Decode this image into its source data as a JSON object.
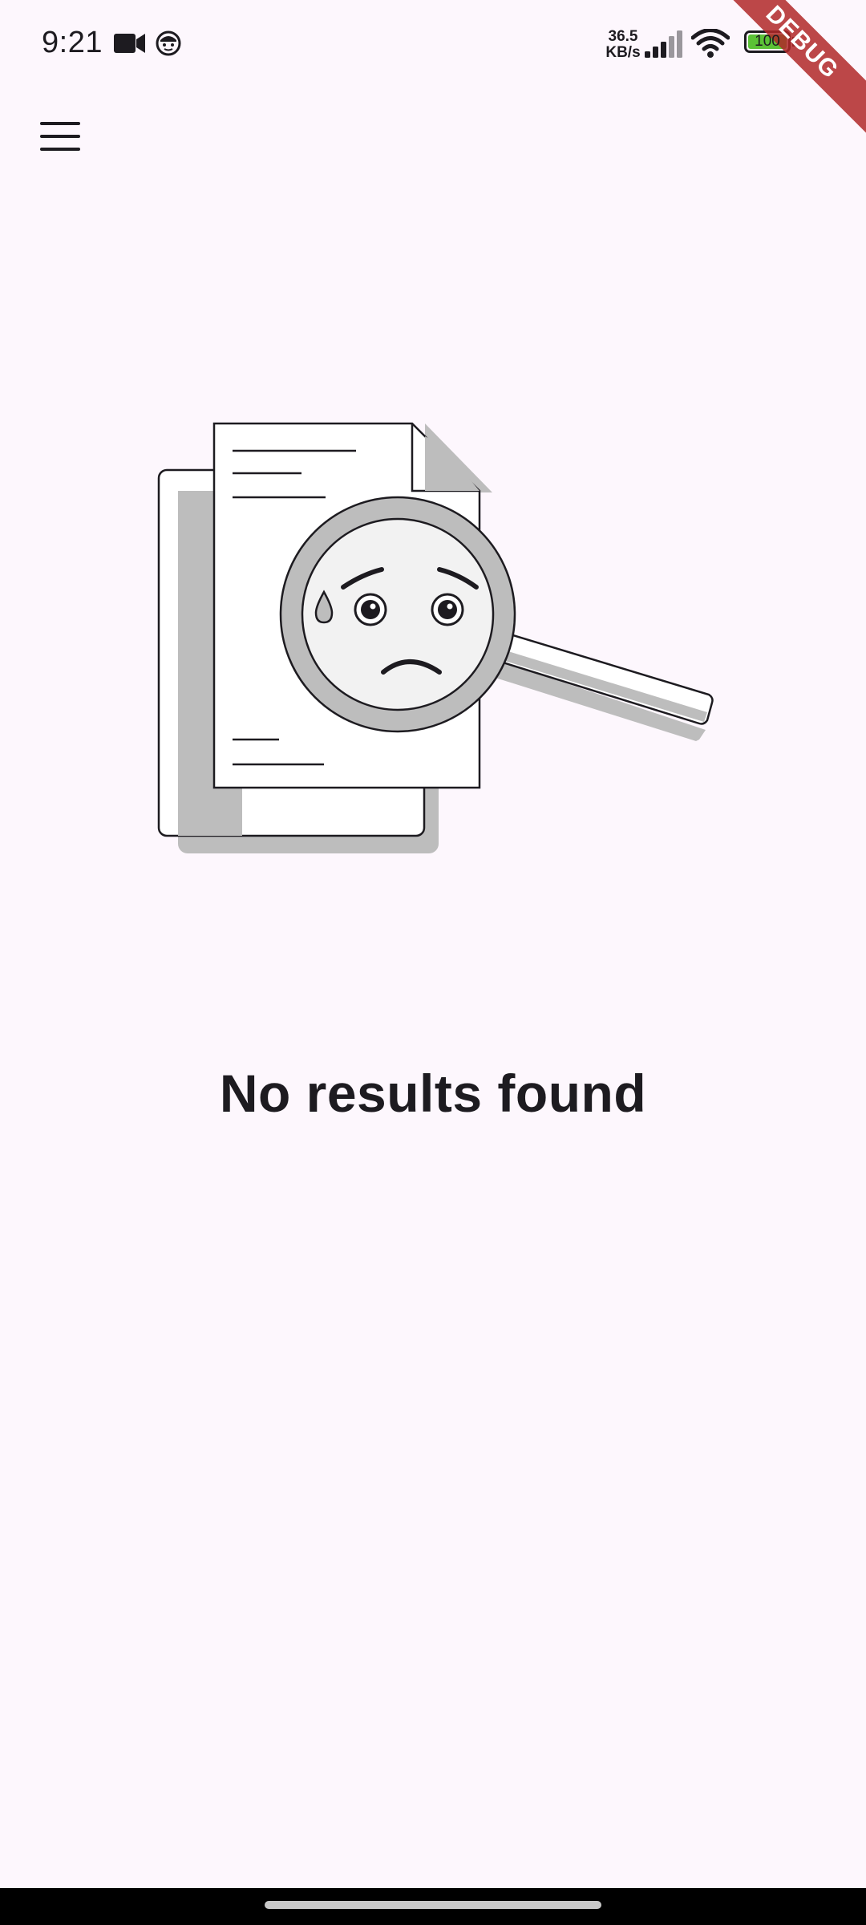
{
  "status_bar": {
    "time": "9:21",
    "net_speed_value": "36.5",
    "net_speed_unit": "KB/s",
    "battery_level": "100",
    "battery_fraction": 1.0,
    "icons": [
      "video-camera-icon",
      "face-icon",
      "signal-icon",
      "wifi-icon",
      "battery-icon"
    ]
  },
  "debug_banner": {
    "label": "DEBUG",
    "color": "#b02828"
  },
  "app_bar": {
    "menu_icon": "hamburger-menu-icon"
  },
  "empty_state": {
    "illustration": "sad-magnifier-document-icon",
    "message": "No results found"
  },
  "colors": {
    "background": "#fdf7fd",
    "text": "#1d1b20",
    "battery_fill": "#5bc236"
  }
}
